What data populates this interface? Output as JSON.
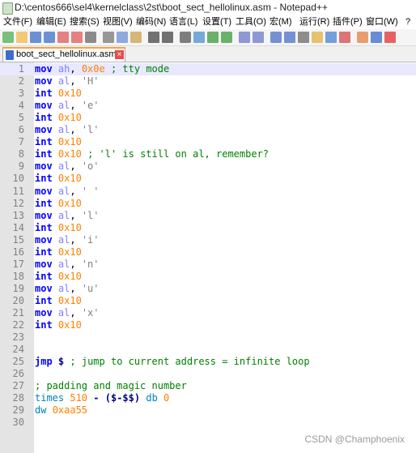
{
  "window": {
    "title": "D:\\centos666\\sel4\\kernelclass\\2st\\boot_sect_hellolinux.asm - Notepad++"
  },
  "menu": [
    "文件(F)",
    "编辑(E)",
    "搜索(S)",
    "视图(V)",
    "编码(N)",
    "语言(L)",
    "设置(T)",
    "工具(O)",
    "宏(M)",
    "运行(R)",
    "插件(P)",
    "窗口(W)",
    "?"
  ],
  "toolbar": [
    "new-file-icon",
    "open-file-icon",
    "save-icon",
    "save-all-icon",
    "close-icon",
    "close-all-icon",
    "print-icon",
    "cut-icon",
    "copy-icon",
    "paste-icon",
    "undo-icon",
    "redo-icon",
    "find-icon",
    "replace-icon",
    "zoom-in-icon",
    "zoom-out-icon",
    "sync-v-icon",
    "sync-h-icon",
    "word-wrap-icon",
    "show-all-chars-icon",
    "indent-guide-icon",
    "define-lang-icon",
    "doc-map-icon",
    "function-list-icon",
    "folder-workspace-icon",
    "monitor-icon",
    "record-macro-icon"
  ],
  "tab": {
    "label": "boot_sect_hellolinux.asm"
  },
  "editor": {
    "lines": [
      {
        "n": "1",
        "t": [
          [
            "mov",
            "kw"
          ],
          [
            " ",
            "plain"
          ],
          [
            "ah",
            "reg"
          ],
          [
            ", ",
            "plain"
          ],
          [
            "0x0e",
            "num"
          ],
          [
            " ",
            "plain"
          ],
          [
            "; tty mode",
            "cmt"
          ]
        ]
      },
      {
        "n": "2",
        "t": [
          [
            "mov",
            "kw"
          ],
          [
            " ",
            "plain"
          ],
          [
            "al",
            "reg"
          ],
          [
            ", ",
            "plain"
          ],
          [
            "'H'",
            "str"
          ]
        ]
      },
      {
        "n": "3",
        "t": [
          [
            "int",
            "kw"
          ],
          [
            " ",
            "plain"
          ],
          [
            "0x10",
            "num"
          ]
        ]
      },
      {
        "n": "4",
        "t": [
          [
            "mov",
            "kw"
          ],
          [
            " ",
            "plain"
          ],
          [
            "al",
            "reg"
          ],
          [
            ", ",
            "plain"
          ],
          [
            "'e'",
            "str"
          ]
        ]
      },
      {
        "n": "5",
        "t": [
          [
            "int",
            "kw"
          ],
          [
            " ",
            "plain"
          ],
          [
            "0x10",
            "num"
          ]
        ]
      },
      {
        "n": "6",
        "t": [
          [
            "mov",
            "kw"
          ],
          [
            " ",
            "plain"
          ],
          [
            "al",
            "reg"
          ],
          [
            ", ",
            "plain"
          ],
          [
            "'l'",
            "str"
          ]
        ]
      },
      {
        "n": "7",
        "t": [
          [
            "int",
            "kw"
          ],
          [
            " ",
            "plain"
          ],
          [
            "0x10",
            "num"
          ]
        ]
      },
      {
        "n": "8",
        "t": [
          [
            "int",
            "kw"
          ],
          [
            " ",
            "plain"
          ],
          [
            "0x10",
            "num"
          ],
          [
            " ",
            "plain"
          ],
          [
            "; 'l' is still on al, remember?",
            "cmt"
          ]
        ]
      },
      {
        "n": "9",
        "t": [
          [
            "mov",
            "kw"
          ],
          [
            " ",
            "plain"
          ],
          [
            "al",
            "reg"
          ],
          [
            ", ",
            "plain"
          ],
          [
            "'o'",
            "str"
          ]
        ]
      },
      {
        "n": "10",
        "t": [
          [
            "int",
            "kw"
          ],
          [
            " ",
            "plain"
          ],
          [
            "0x10",
            "num"
          ]
        ]
      },
      {
        "n": "11",
        "t": [
          [
            "mov",
            "kw"
          ],
          [
            " ",
            "plain"
          ],
          [
            "al",
            "reg"
          ],
          [
            ", ",
            "plain"
          ],
          [
            "' '",
            "str"
          ]
        ]
      },
      {
        "n": "12",
        "t": [
          [
            "int",
            "kw"
          ],
          [
            " ",
            "plain"
          ],
          [
            "0x10",
            "num"
          ]
        ]
      },
      {
        "n": "13",
        "t": [
          [
            "mov",
            "kw"
          ],
          [
            " ",
            "plain"
          ],
          [
            "al",
            "reg"
          ],
          [
            ", ",
            "plain"
          ],
          [
            "'l'",
            "str"
          ]
        ]
      },
      {
        "n": "14",
        "t": [
          [
            "int",
            "kw"
          ],
          [
            " ",
            "plain"
          ],
          [
            "0x10",
            "num"
          ]
        ]
      },
      {
        "n": "15",
        "t": [
          [
            "mov",
            "kw"
          ],
          [
            " ",
            "plain"
          ],
          [
            "al",
            "reg"
          ],
          [
            ", ",
            "plain"
          ],
          [
            "'i'",
            "str"
          ]
        ]
      },
      {
        "n": "16",
        "t": [
          [
            "int",
            "kw"
          ],
          [
            " ",
            "plain"
          ],
          [
            "0x10",
            "num"
          ]
        ]
      },
      {
        "n": "17",
        "t": [
          [
            "mov",
            "kw"
          ],
          [
            " ",
            "plain"
          ],
          [
            "al",
            "reg"
          ],
          [
            ", ",
            "plain"
          ],
          [
            "'n'",
            "str"
          ]
        ]
      },
      {
        "n": "18",
        "t": [
          [
            "int",
            "kw"
          ],
          [
            " ",
            "plain"
          ],
          [
            "0x10",
            "num"
          ]
        ]
      },
      {
        "n": "19",
        "t": [
          [
            "mov",
            "kw"
          ],
          [
            " ",
            "plain"
          ],
          [
            "al",
            "reg"
          ],
          [
            ", ",
            "plain"
          ],
          [
            "'u'",
            "str"
          ]
        ]
      },
      {
        "n": "20",
        "t": [
          [
            "int",
            "kw"
          ],
          [
            " ",
            "plain"
          ],
          [
            "0x10",
            "num"
          ]
        ]
      },
      {
        "n": "21",
        "t": [
          [
            "mov",
            "kw"
          ],
          [
            " ",
            "plain"
          ],
          [
            "al",
            "reg"
          ],
          [
            ", ",
            "plain"
          ],
          [
            "'x'",
            "str"
          ]
        ]
      },
      {
        "n": "22",
        "t": [
          [
            "int",
            "kw"
          ],
          [
            " ",
            "plain"
          ],
          [
            "0x10",
            "num"
          ]
        ]
      },
      {
        "n": "23",
        "t": []
      },
      {
        "n": "24",
        "t": []
      },
      {
        "n": "25",
        "t": [
          [
            "jmp",
            "kw"
          ],
          [
            " ",
            "plain"
          ],
          [
            "$",
            "op"
          ],
          [
            " ",
            "plain"
          ],
          [
            "; jump to current address = infinite loop",
            "cmt"
          ]
        ]
      },
      {
        "n": "26",
        "t": []
      },
      {
        "n": "27",
        "t": [
          [
            "; padding and magic number",
            "cmt"
          ]
        ]
      },
      {
        "n": "28",
        "t": [
          [
            "times",
            "dir"
          ],
          [
            " ",
            "plain"
          ],
          [
            "510",
            "num"
          ],
          [
            " ",
            "plain"
          ],
          [
            "-",
            "op"
          ],
          [
            " ",
            "plain"
          ],
          [
            "($-$$)",
            "op"
          ],
          [
            " ",
            "plain"
          ],
          [
            "db",
            "dir"
          ],
          [
            " ",
            "plain"
          ],
          [
            "0",
            "num"
          ]
        ]
      },
      {
        "n": "29",
        "t": [
          [
            "dw",
            "dir"
          ],
          [
            " ",
            "plain"
          ],
          [
            "0xaa55",
            "num"
          ]
        ]
      },
      {
        "n": "30",
        "t": []
      }
    ]
  },
  "watermark": "CSDN @Champhoenix"
}
